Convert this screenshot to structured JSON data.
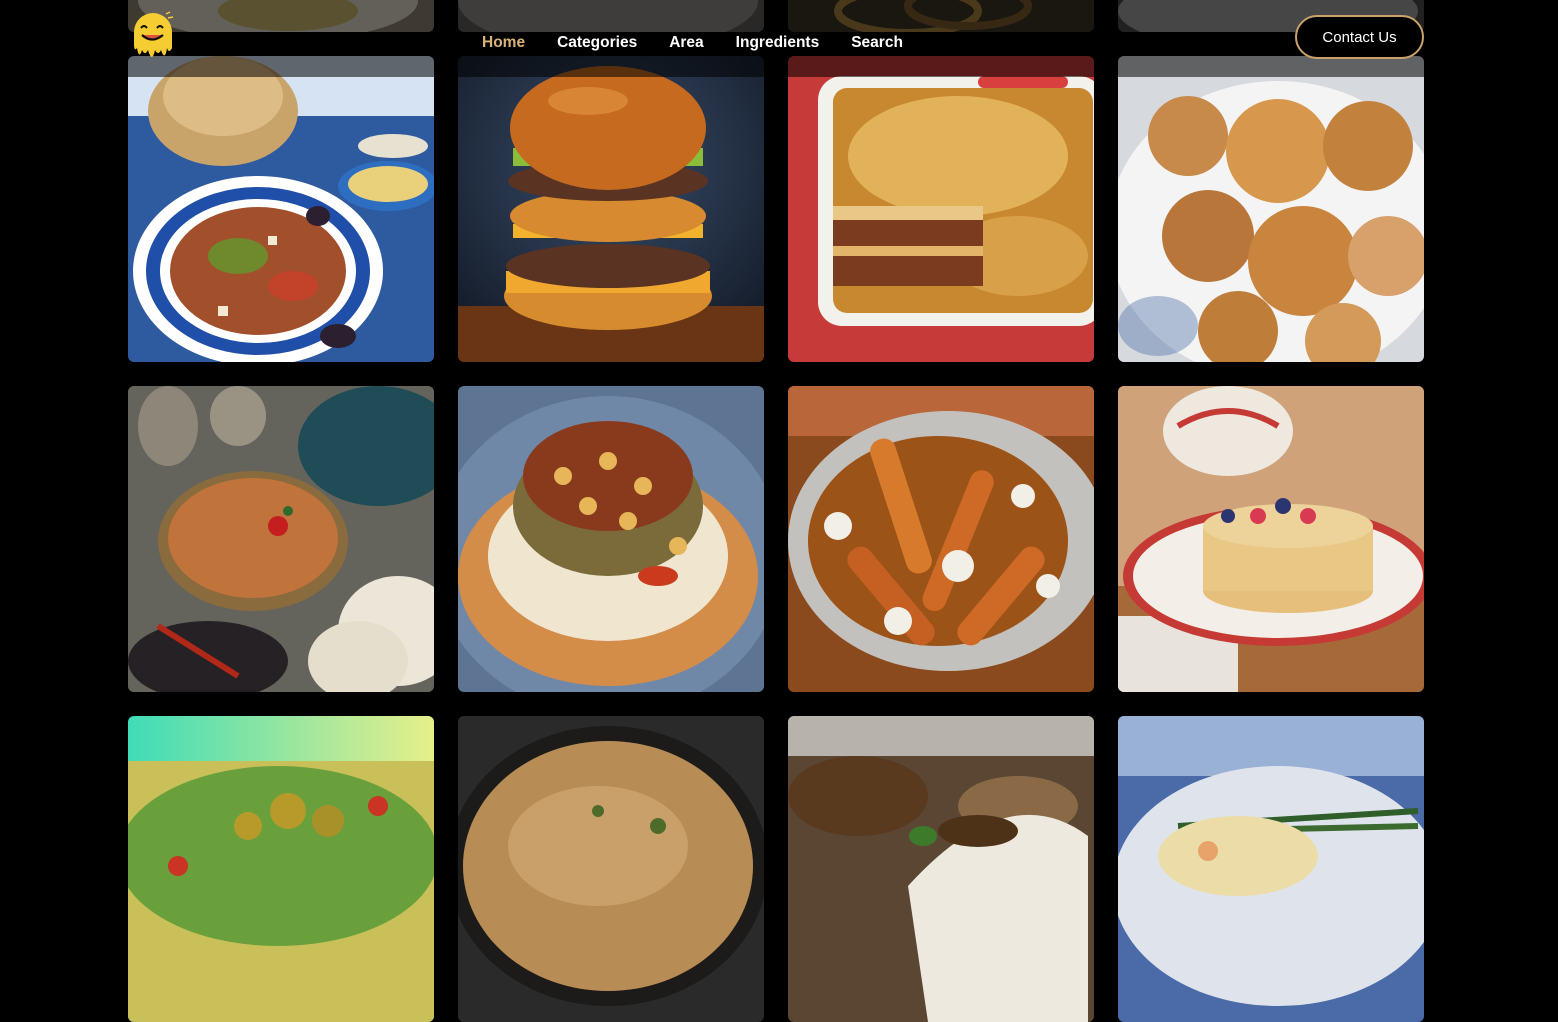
{
  "brand": {
    "logo_icon": "smiley-drip-logo-icon"
  },
  "nav": {
    "items": [
      {
        "label": "Home",
        "active": true
      },
      {
        "label": "Categories",
        "active": false
      },
      {
        "label": "Area",
        "active": false
      },
      {
        "label": "Ingredients",
        "active": false
      },
      {
        "label": "Search",
        "active": false
      }
    ]
  },
  "contact_button": {
    "label": "Contact Us"
  },
  "colors": {
    "accent": "#d8b47a",
    "background": "#000000",
    "text": "#ffffff"
  },
  "meals": [
    {
      "image": "plated-dish-photo"
    },
    {
      "image": "soup-bowl-photo"
    },
    {
      "image": "onion-dish-photo"
    },
    {
      "image": "white-plate-photo"
    },
    {
      "image": "tunisian-salad-photo"
    },
    {
      "image": "burger-photo"
    },
    {
      "image": "lasagna-photo"
    },
    {
      "image": "sugared-fritters-photo"
    },
    {
      "image": "lentil-soup-photo"
    },
    {
      "image": "koshari-photo"
    },
    {
      "image": "poutine-photo"
    },
    {
      "image": "pancakes-photo"
    },
    {
      "image": "nachos-photo"
    },
    {
      "image": "baked-casserole-photo"
    },
    {
      "image": "chicken-wrap-photo"
    },
    {
      "image": "fish-pie-photo"
    }
  ]
}
